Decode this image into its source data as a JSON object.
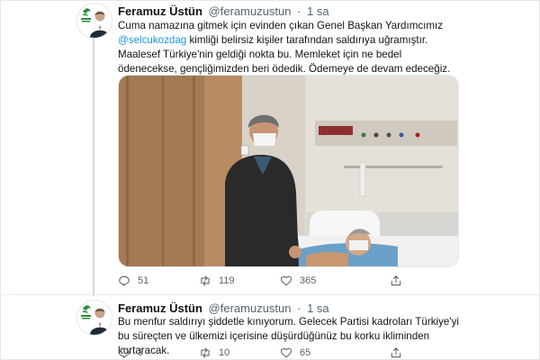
{
  "tweets": [
    {
      "author_name": "Feramuz Üstün",
      "handle": "@feramuzustun",
      "separator": "·",
      "time": "1 sa",
      "text_before_mention": "Cuma namazına gitmek için evinden çıkan Genel Başkan Yardımcımız",
      "mention": "@selcukozdag",
      "text_after_mention": "kimliği belirsiz kişiler tarafından saldırıya uğramıştır. Maalesef Türkiye'nin geldiği nokta bu. Memleket için ne bedel ödenecekse, gençliğimizden beri ödedik. Ödemeye de devam edeceğiz.",
      "counts": {
        "replies": "51",
        "retweets": "119",
        "likes": "365"
      }
    },
    {
      "author_name": "Feramuz Üstün",
      "handle": "@feramuzustun",
      "separator": "·",
      "time": "1 sa",
      "text": "Bu menfur saldırıyı şiddetle kınıyorum. Gelecek Partisi kadroları Türkiye'yi bu süreçten ve ülkemizi içerisine düşürdüğünüz bu korku ikliminden kurtaracak.",
      "counts": {
        "replies": "3",
        "retweets": "10",
        "likes": "65"
      }
    }
  ],
  "icons": {
    "reply": "reply-icon",
    "retweet": "retweet-icon",
    "like": "like-icon",
    "share": "share-icon"
  },
  "colors": {
    "link": "#1b95e0",
    "muted": "#536471",
    "text": "#0f1419",
    "brand_green": "#2e8b3a"
  }
}
